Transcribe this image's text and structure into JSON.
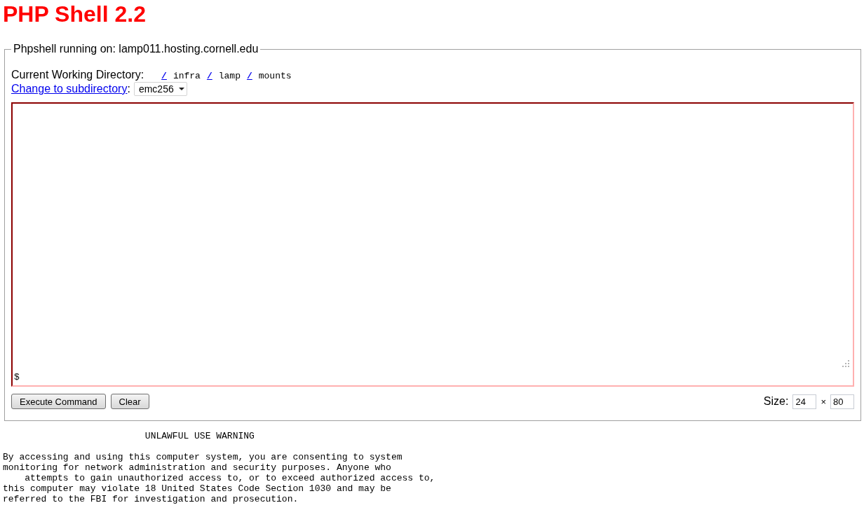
{
  "page_title": "PHP Shell 2.2",
  "panel": {
    "legend": "Phpshell running on: lamp011.hosting.cornell.edu",
    "cwd_label": "Current Working Directory:",
    "path": [
      {
        "link": "/",
        "name": "infra"
      },
      {
        "link": "/",
        "name": "lamp"
      },
      {
        "link": "/",
        "name": "mounts"
      }
    ],
    "subdirectory_link": "Change to subdirectory",
    "subdirectory_suffix": ":",
    "subdirectory_select": {
      "value": "emc256"
    },
    "terminal": {
      "prompt": "$"
    },
    "buttons": [
      "Execute Command",
      "Clear"
    ],
    "size": {
      "label": "Size:",
      "rows": "24",
      "times": "×",
      "columns": "80"
    }
  },
  "warning": {
    "title": "UNLAWFUL USE WARNING",
    "text": "By accessing and using this computer system, you are consenting to system\nmonitoring for network administration and security purposes. Anyone who\n    attempts to gain unauthorized access to, or to exceed authorized access to,\nthis computer may violate 18 United States Code Section 1030 and may be\nreferred to the FBI for investigation and prosecution."
  }
}
